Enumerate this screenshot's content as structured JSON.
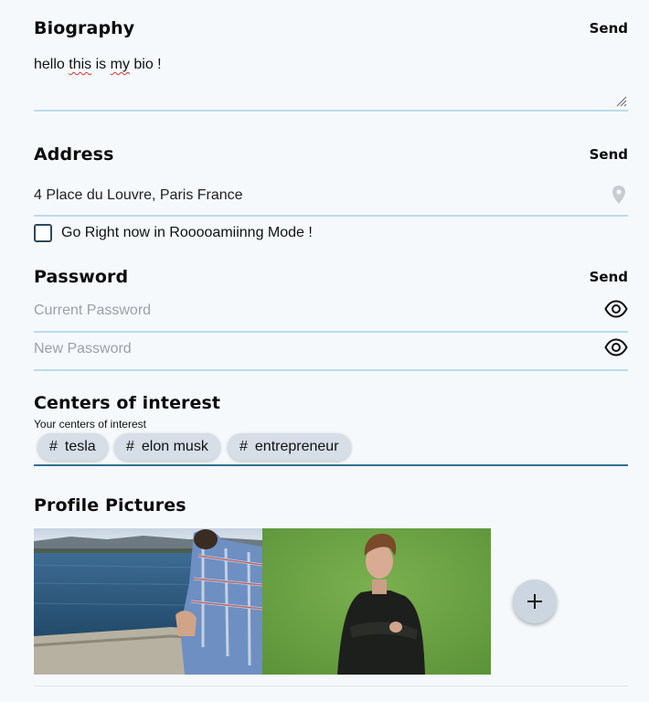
{
  "biography": {
    "title": "Biography",
    "send_label": "Send",
    "text_plain_1": "hello ",
    "text_err_1": "this",
    "text_plain_2": " is ",
    "text_err_2": "my",
    "text_plain_3": " bio !"
  },
  "address": {
    "title": "Address",
    "send_label": "Send",
    "value": "4 Place du Louvre, Paris France",
    "roaming_label": "Go Right now in Rooooamiinng Mode !",
    "roaming_checked": false
  },
  "password": {
    "title": "Password",
    "send_label": "Send",
    "current_placeholder": "Current Password",
    "new_placeholder": "New Password"
  },
  "interests": {
    "title": "Centers of interest",
    "subtitle": "Your centers of interest",
    "hash": "#",
    "tags": [
      "tesla",
      "elon musk",
      "entrepreneur"
    ]
  },
  "pictures": {
    "title": "Profile Pictures",
    "add_label": "+"
  },
  "colors": {
    "underline": "#b9dcec",
    "chip_bg": "#d6dee7",
    "active_underline": "#2f6f8f"
  },
  "icons": {
    "location": "location-pin-icon",
    "visibility": "eye-icon",
    "add": "plus-icon",
    "resize": "resize-handle-icon"
  }
}
